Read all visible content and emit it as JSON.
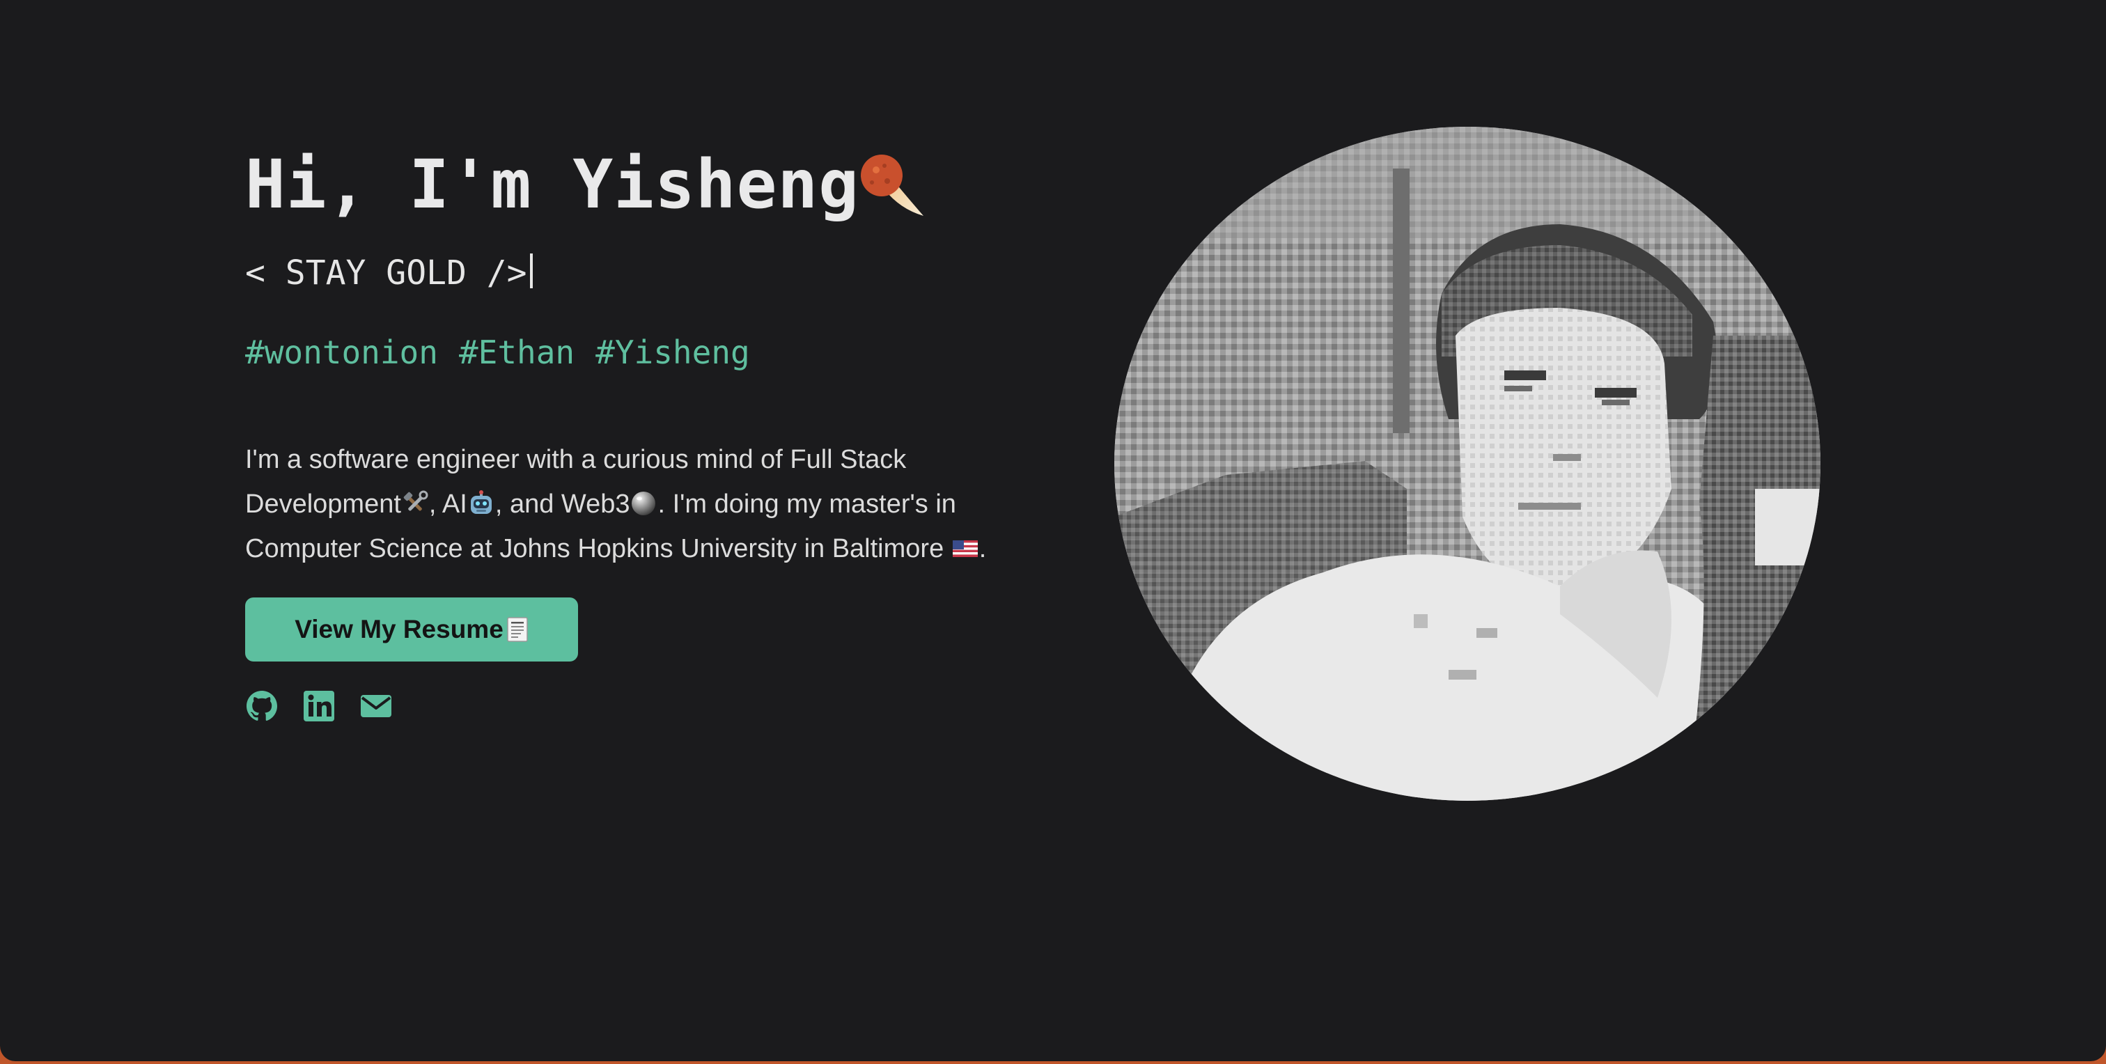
{
  "hero": {
    "greeting": "Hi, I'm Yisheng",
    "tagline": "< STAY GOLD />",
    "hashtags": [
      "#wontonion",
      "#Ethan",
      "#Yisheng"
    ],
    "bio": {
      "part1": "I'm a software engineer with a curious mind of Full Stack Development",
      "part2": ", AI",
      "part3": ", and Web3",
      "part4": ". I'm doing my master's in Computer Science at Johns Hopkins University in Baltimore ",
      "part5": "."
    },
    "resume_button": "View My Resume"
  },
  "icons": {
    "title_emoji": "meteor-icon",
    "development": "hammer-wrench-icon",
    "ai": "robot-icon",
    "web3": "crystal-ball-icon",
    "location": "us-flag-icon",
    "resume": "document-icon",
    "socials": [
      "github-icon",
      "linkedin-icon",
      "email-icon"
    ]
  },
  "colors": {
    "background": "#1b1b1d",
    "accent": "#5dbf9f",
    "text": "#e9e9ea"
  }
}
